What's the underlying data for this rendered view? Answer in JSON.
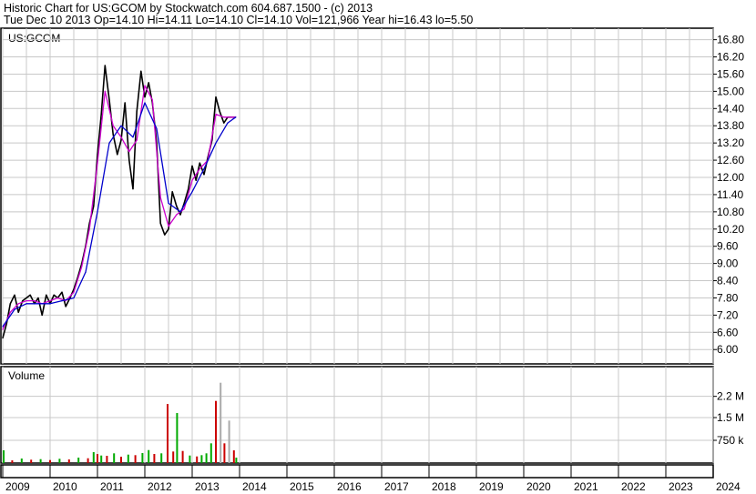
{
  "header": {
    "line1": "Historic Chart for US:GCOM by Stockwatch.com 604.687.1500 - (c) 2013",
    "line2": "Tue Dec 10 2013   Op=14.10   Hi=14.11   Lo=14.10   Cl=14.10   Vol=121,966   Year hi=16.43   lo=5.50"
  },
  "chart_data": {
    "type": "line",
    "symbol_label": "US:GCOM",
    "price_panel": {
      "ylim": [
        5.5,
        17.2
      ],
      "y_ticks": [
        "16.80",
        "16.20",
        "15.60",
        "15.00",
        "14.40",
        "13.80",
        "13.20",
        "12.60",
        "12.00",
        "11.40",
        "10.80",
        "10.20",
        "9.60",
        "9.00",
        "8.40",
        "7.80",
        "7.20",
        "6.60",
        "6.00"
      ],
      "y_tick_values": [
        16.8,
        16.2,
        15.6,
        15.0,
        14.4,
        13.8,
        13.2,
        12.6,
        12.0,
        11.4,
        10.8,
        10.2,
        9.6,
        9.0,
        8.4,
        7.8,
        7.2,
        6.6,
        6.0
      ],
      "series": [
        {
          "color": "#000000",
          "x": [
            2009.0,
            2009.08,
            2009.16,
            2009.25,
            2009.33,
            2009.42,
            2009.5,
            2009.58,
            2009.67,
            2009.75,
            2009.83,
            2009.92,
            2010.0,
            2010.08,
            2010.16,
            2010.25,
            2010.33,
            2010.42,
            2010.5,
            2010.58,
            2010.67,
            2010.75,
            2010.83,
            2010.92,
            2011.0,
            2011.08,
            2011.16,
            2011.25,
            2011.33,
            2011.42,
            2011.5,
            2011.58,
            2011.67,
            2011.75,
            2011.83,
            2011.92,
            2012.0,
            2012.08,
            2012.16,
            2012.25,
            2012.33,
            2012.42,
            2012.5,
            2012.58,
            2012.67,
            2012.75,
            2012.83,
            2012.92,
            2013.0,
            2013.08,
            2013.16,
            2013.25,
            2013.33,
            2013.42,
            2013.5,
            2013.58,
            2013.67,
            2013.75,
            2013.83,
            2013.92
          ],
          "y": [
            6.4,
            6.9,
            7.6,
            7.9,
            7.3,
            7.7,
            7.8,
            7.9,
            7.6,
            7.8,
            7.2,
            7.9,
            7.6,
            7.9,
            7.8,
            8.0,
            7.5,
            7.8,
            8.1,
            8.5,
            9.0,
            9.6,
            10.4,
            11.0,
            12.8,
            14.2,
            15.9,
            14.7,
            13.5,
            12.8,
            13.3,
            14.6,
            12.6,
            11.6,
            14.3,
            15.7,
            14.8,
            15.3,
            14.6,
            13.2,
            10.4,
            10.0,
            10.2,
            11.5,
            11.0,
            10.7,
            11.1,
            11.6,
            12.4,
            11.9,
            12.5,
            12.1,
            12.7,
            13.3,
            14.8,
            14.3,
            13.9,
            14.1,
            14.1,
            14.1
          ]
        },
        {
          "color": "#cc00cc",
          "x": [
            2009.0,
            2009.16,
            2009.33,
            2009.5,
            2009.67,
            2009.83,
            2010.0,
            2010.16,
            2010.33,
            2010.5,
            2010.67,
            2010.83,
            2011.0,
            2011.16,
            2011.33,
            2011.5,
            2011.67,
            2011.83,
            2012.0,
            2012.16,
            2012.33,
            2012.5,
            2012.67,
            2012.83,
            2013.0,
            2013.16,
            2013.33,
            2013.5,
            2013.67,
            2013.83,
            2013.92
          ],
          "y": [
            6.7,
            7.3,
            7.6,
            7.7,
            7.7,
            7.6,
            7.7,
            7.8,
            7.7,
            8.0,
            8.9,
            10.2,
            12.5,
            15.0,
            13.8,
            13.4,
            12.9,
            13.3,
            15.2,
            14.7,
            11.3,
            10.3,
            10.7,
            10.9,
            11.9,
            12.3,
            12.6,
            14.2,
            14.1,
            14.1,
            14.1
          ]
        },
        {
          "color": "#0000cc",
          "x": [
            2009.0,
            2009.25,
            2009.5,
            2009.75,
            2010.0,
            2010.25,
            2010.5,
            2010.75,
            2011.0,
            2011.25,
            2011.5,
            2011.75,
            2012.0,
            2012.25,
            2012.5,
            2012.75,
            2013.0,
            2013.25,
            2013.5,
            2013.75,
            2013.92
          ],
          "y": [
            6.8,
            7.4,
            7.6,
            7.6,
            7.6,
            7.7,
            7.8,
            8.7,
            10.8,
            13.2,
            13.8,
            13.4,
            14.6,
            13.7,
            11.1,
            10.8,
            11.5,
            12.3,
            13.2,
            13.9,
            14.1
          ]
        }
      ]
    },
    "volume_panel": {
      "label": "Volume",
      "ylim": [
        0,
        3000000
      ],
      "y_ticks": [
        "2.2 M",
        "1.5 M",
        "750 k"
      ],
      "y_tick_values": [
        2200000,
        1500000,
        750000
      ],
      "bars": [
        {
          "x": 2009.02,
          "v": 420000,
          "c": "#00aa00"
        },
        {
          "x": 2009.2,
          "v": 90000,
          "c": "#cc0000"
        },
        {
          "x": 2009.4,
          "v": 150000,
          "c": "#00aa00"
        },
        {
          "x": 2009.6,
          "v": 110000,
          "c": "#cc0000"
        },
        {
          "x": 2009.8,
          "v": 130000,
          "c": "#00aa00"
        },
        {
          "x": 2010.0,
          "v": 100000,
          "c": "#cc0000"
        },
        {
          "x": 2010.2,
          "v": 140000,
          "c": "#00aa00"
        },
        {
          "x": 2010.4,
          "v": 120000,
          "c": "#cc0000"
        },
        {
          "x": 2010.6,
          "v": 180000,
          "c": "#00aa00"
        },
        {
          "x": 2010.8,
          "v": 160000,
          "c": "#cc0000"
        },
        {
          "x": 2010.92,
          "v": 360000,
          "c": "#00aa00"
        },
        {
          "x": 2011.0,
          "v": 300000,
          "c": "#cc0000"
        },
        {
          "x": 2011.08,
          "v": 250000,
          "c": "#00aa00"
        },
        {
          "x": 2011.2,
          "v": 240000,
          "c": "#cc0000"
        },
        {
          "x": 2011.35,
          "v": 320000,
          "c": "#00aa00"
        },
        {
          "x": 2011.5,
          "v": 210000,
          "c": "#cc0000"
        },
        {
          "x": 2011.65,
          "v": 280000,
          "c": "#00aa00"
        },
        {
          "x": 2011.8,
          "v": 260000,
          "c": "#cc0000"
        },
        {
          "x": 2011.95,
          "v": 330000,
          "c": "#00aa00"
        },
        {
          "x": 2012.08,
          "v": 430000,
          "c": "#00aa00"
        },
        {
          "x": 2012.2,
          "v": 300000,
          "c": "#cc0000"
        },
        {
          "x": 2012.35,
          "v": 320000,
          "c": "#00aa00"
        },
        {
          "x": 2012.48,
          "v": 1950000,
          "c": "#cc0000"
        },
        {
          "x": 2012.6,
          "v": 380000,
          "c": "#cc0000"
        },
        {
          "x": 2012.68,
          "v": 1650000,
          "c": "#00aa00"
        },
        {
          "x": 2012.8,
          "v": 400000,
          "c": "#cc0000"
        },
        {
          "x": 2012.95,
          "v": 250000,
          "c": "#00aa00"
        },
        {
          "x": 2013.1,
          "v": 220000,
          "c": "#cc0000"
        },
        {
          "x": 2013.2,
          "v": 260000,
          "c": "#00aa00"
        },
        {
          "x": 2013.3,
          "v": 320000,
          "c": "#00aa00"
        },
        {
          "x": 2013.4,
          "v": 650000,
          "c": "#00aa00"
        },
        {
          "x": 2013.5,
          "v": 2050000,
          "c": "#cc0000"
        },
        {
          "x": 2013.6,
          "v": 2650000,
          "c": "#aaaaaa"
        },
        {
          "x": 2013.68,
          "v": 650000,
          "c": "#cc0000"
        },
        {
          "x": 2013.78,
          "v": 1400000,
          "c": "#aaaaaa"
        },
        {
          "x": 2013.88,
          "v": 420000,
          "c": "#cc0000"
        },
        {
          "x": 2013.93,
          "v": 180000,
          "c": "#00aa00"
        }
      ]
    },
    "x_axis": {
      "labels": [
        "2009",
        "2010",
        "2011",
        "2012",
        "2013",
        "2014",
        "2015",
        "2016",
        "2017",
        "2018",
        "2019",
        "2020",
        "2021",
        "2022",
        "2023",
        "2024"
      ],
      "values": [
        2009,
        2010,
        2011,
        2012,
        2013,
        2014,
        2015,
        2016,
        2017,
        2018,
        2019,
        2020,
        2021,
        2022,
        2023,
        2024
      ],
      "xlim": [
        2009.0,
        2024.0
      ]
    },
    "grid": true,
    "colors": {
      "grid": "#c8c8c8",
      "price": "#000000",
      "ma_short": "#cc00cc",
      "ma_long": "#0000cc"
    }
  }
}
